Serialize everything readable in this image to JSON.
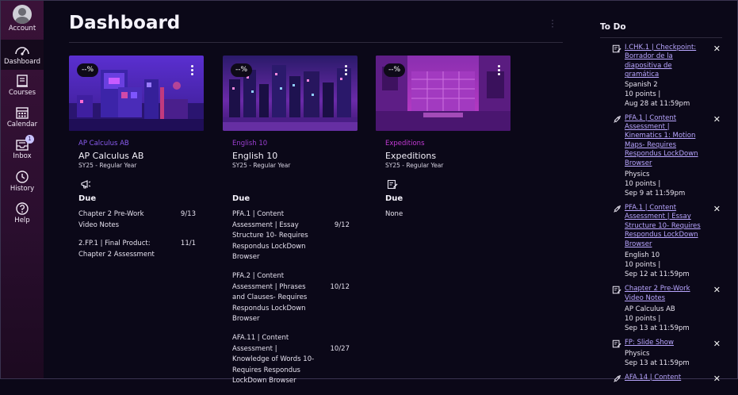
{
  "nav": [
    {
      "label": "Account",
      "icon": "avatar-icon"
    },
    {
      "label": "Dashboard",
      "icon": "dashboard-icon"
    },
    {
      "label": "Courses",
      "icon": "courses-icon"
    },
    {
      "label": "Calendar",
      "icon": "calendar-icon"
    },
    {
      "label": "Inbox",
      "icon": "inbox-icon",
      "badge": "1"
    },
    {
      "label": "History",
      "icon": "history-icon"
    },
    {
      "label": "Help",
      "icon": "help-icon"
    }
  ],
  "page_title": "Dashboard",
  "cards": [
    {
      "grade": "--%",
      "code": "AP Calculus AB",
      "name": "AP Calculus AB",
      "term": "SY25 - Regular Year",
      "accent": "#8a5cf0",
      "action_icon": "announcement-icon",
      "due_heading": "Due",
      "due": [
        {
          "title": "Chapter 2 Pre-Work Video Notes",
          "date": "9/13"
        },
        {
          "title": "2.FP.1 | Final Product: Chapter 2 Assessment",
          "date": "11/1"
        }
      ]
    },
    {
      "grade": "--%",
      "code": "English 10",
      "name": "English 10",
      "term": "SY25 - Regular Year",
      "accent": "#9b3fd0",
      "action_icon": "",
      "due_heading": "Due",
      "due": [
        {
          "title": "PFA.1 | Content Assessment | Essay Structure 10- Requires Respondus LockDown Browser",
          "date": "9/12"
        },
        {
          "title": "PFA.2 | Content Assessment | Phrases and Clauses- Requires Respondus LockDown Browser",
          "date": "10/12"
        },
        {
          "title": "AFA.11 | Content Assessment | Knowledge of Words 10- Requires Respondus LockDown Browser",
          "date": "10/27"
        }
      ]
    },
    {
      "grade": "--%",
      "code": "Expeditions",
      "name": "Expeditions",
      "term": "SY25 - Regular Year",
      "accent": "#c23ad4",
      "action_icon": "assignment-icon",
      "due_heading": "Due",
      "due_none": "None",
      "due": []
    }
  ],
  "todo": {
    "heading": "To Do",
    "items": [
      {
        "icon": "assignment-icon",
        "title": "I.CHK.1 | Checkpoint: Borrador de la diapositiva de gramática",
        "course": "Spanish 2",
        "points": "10 points  |",
        "due": "Aug 28 at 11:59pm"
      },
      {
        "icon": "quiz-icon",
        "title": "PFA.1 | Content Assessment | Kinematics 1: Motion Maps- Requires Respondus LockDown Browser",
        "course": "Physics",
        "points": "10 points  |",
        "due": "Sep 9 at 11:59pm"
      },
      {
        "icon": "quiz-icon",
        "title": "PFA.1 | Content Assessment | Essay Structure 10- Requires Respondus LockDown Browser",
        "course": "English 10",
        "points": "10 points  |",
        "due": "Sep 12 at 11:59pm"
      },
      {
        "icon": "assignment-icon",
        "title": "Chapter 2 Pre-Work Video Notes",
        "course": "AP Calculus AB",
        "points": "10 points  |",
        "due": "Sep 13 at 11:59pm"
      },
      {
        "icon": "assignment-icon",
        "title": "FP: Slide Show",
        "course": "Physics",
        "points": "",
        "due": "Sep 13 at 11:59pm"
      },
      {
        "icon": "quiz-icon",
        "title": "AFA.14 | Content",
        "course": "",
        "points": "",
        "due": ""
      }
    ],
    "close_glyph": "✕"
  },
  "colors": {
    "background": "#0b0818",
    "nav_top": "#3a1238",
    "link": "#b9a6ff"
  }
}
